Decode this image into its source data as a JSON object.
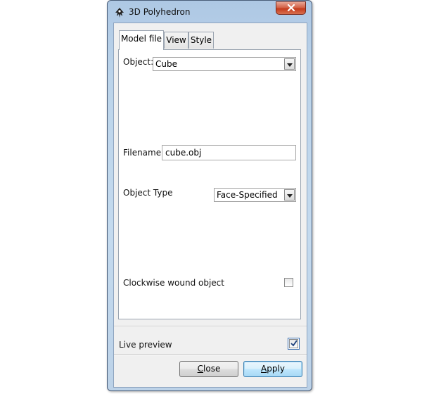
{
  "window": {
    "title": "3D Polyhedron"
  },
  "tabs": [
    {
      "label": "Model file",
      "active": true
    },
    {
      "label": "View",
      "active": false
    },
    {
      "label": "Style",
      "active": false
    }
  ],
  "model_file": {
    "object_label": "Object:",
    "object_value": "Cube",
    "filename_label": "Filename:",
    "filename_value": "cube.obj",
    "object_type_label": "Object Type",
    "object_type_value": "Face-Specified",
    "clockwise_label": "Clockwise wound object",
    "clockwise_checked": false
  },
  "live_preview": {
    "label": "Live preview",
    "checked": true
  },
  "buttons": {
    "close_first": "C",
    "close_rest": "lose",
    "apply_first": "A",
    "apply_rest": "pply"
  },
  "icons": {
    "app": "inkscape-icon",
    "window_close": "close-icon",
    "dropdown": "chevron-down-icon",
    "check": "checkmark-icon"
  }
}
